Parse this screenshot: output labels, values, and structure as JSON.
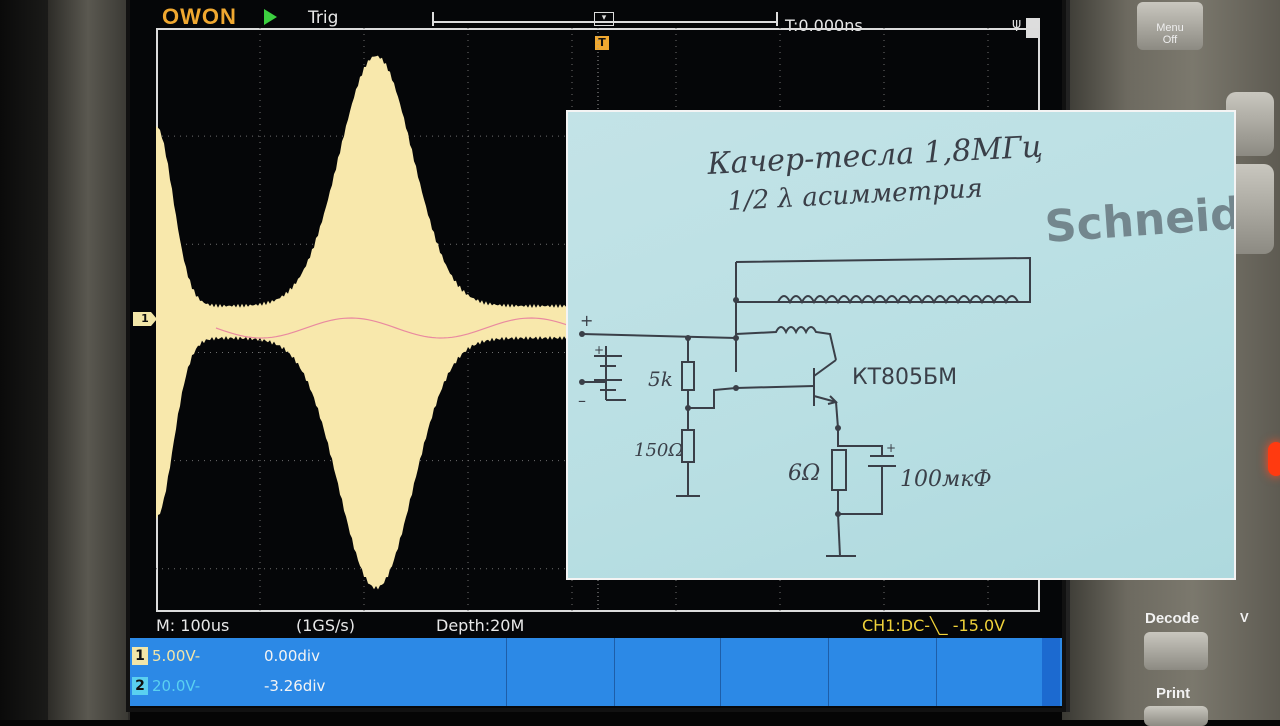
{
  "scope": {
    "brand": "OWON",
    "run_state": "Trig",
    "trigger_time": "T:0.000ns",
    "trigger_marker": "T",
    "ch1_marker": "1",
    "timebase": "M: 100us",
    "sample_rate": "(1GS/s)",
    "depth": "Depth:20M",
    "trigger_info": "CH1:DC-╲_ -15.0V",
    "channels": [
      {
        "tag": "1",
        "scale": "5.00V-",
        "position": "0.00div",
        "color": "#f2e6a8"
      },
      {
        "tag": "2",
        "scale": "20.0V-",
        "position": "-3.26div",
        "color": "#5ad0f0"
      }
    ],
    "wave_color": "#f8e8ac",
    "ch2_color": "#e98aa0"
  },
  "panel": {
    "menu_off_label": "Menu\nOff",
    "decode_label": "Decode",
    "print_label": "Print",
    "v_label": "V"
  },
  "schematic": {
    "title_line1": "Качер-тесла 1,8МГц",
    "title_line2": "1/2 λ асимметрия",
    "transistor": "КТ805БМ",
    "r1": "5k",
    "r2": "150Ω",
    "r3": "6Ω",
    "cap": "100мкФ",
    "plus": "+",
    "minus": "–",
    "cap_plus": "+",
    "watermark": "Schneider Electric"
  }
}
